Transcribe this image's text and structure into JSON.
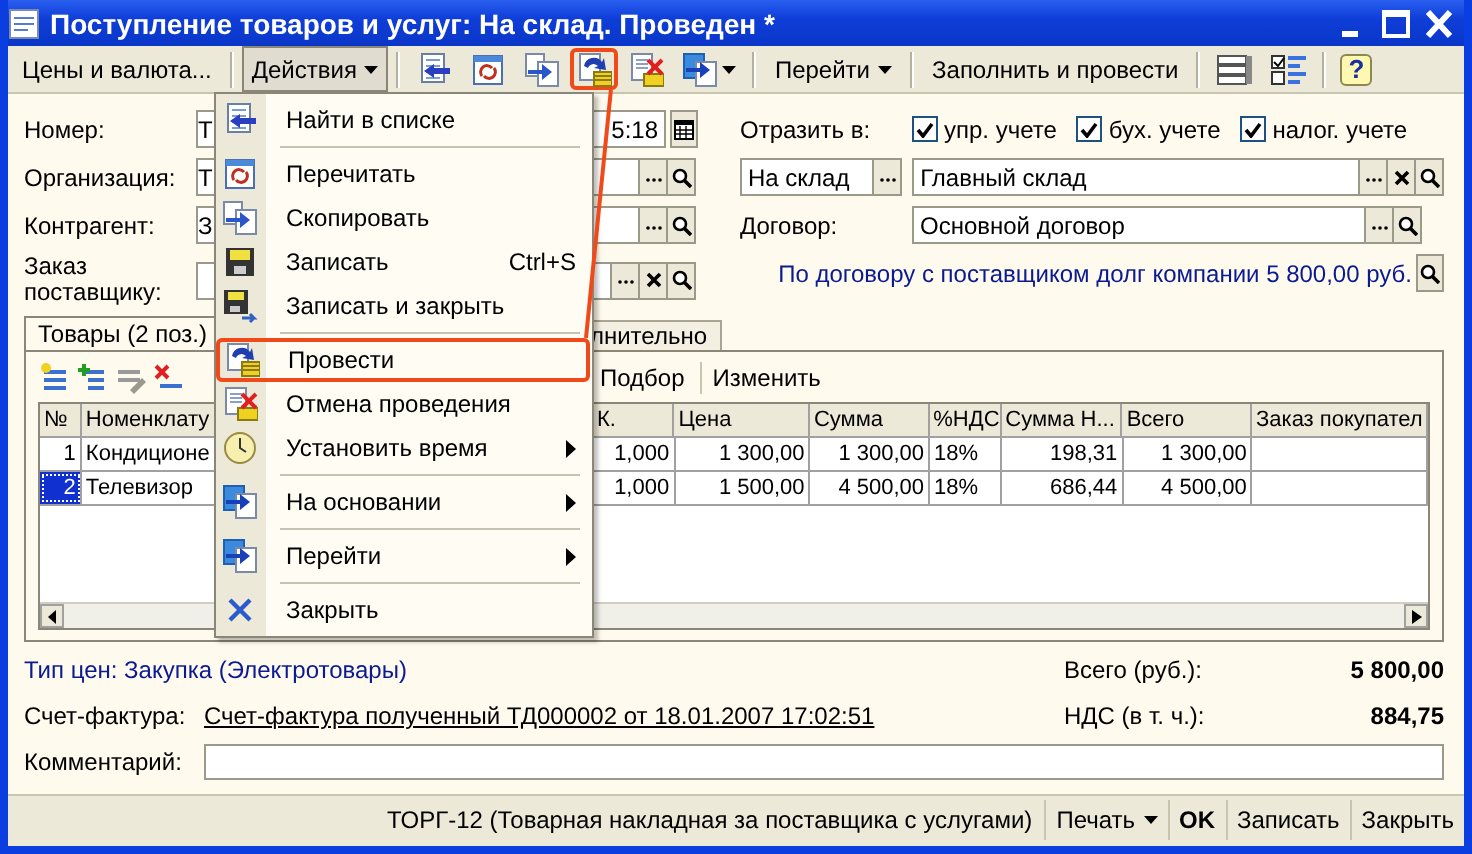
{
  "window": {
    "title": "Поступление товаров и услуг: На склад. Проведен *"
  },
  "toolbar": [
    {
      "kind": "button",
      "label": "Цены и валюта..."
    },
    {
      "kind": "separator"
    },
    {
      "kind": "menu",
      "label": "Действия",
      "open": true
    },
    {
      "kind": "separator"
    },
    {
      "kind": "icon",
      "highlighted": false,
      "dropdown": false
    },
    {
      "kind": "icon",
      "highlighted": false,
      "dropdown": false
    },
    {
      "kind": "icon",
      "highlighted": false,
      "dropdown": false
    },
    {
      "kind": "icon",
      "highlighted": true,
      "dropdown": false
    },
    {
      "kind": "icon",
      "highlighted": false,
      "dropdown": false
    },
    {
      "kind": "icon",
      "highlighted": false,
      "dropdown": true
    },
    {
      "kind": "separator"
    },
    {
      "kind": "menu",
      "label": "Перейти",
      "open": false
    },
    {
      "kind": "separator"
    },
    {
      "kind": "button",
      "label": "Заполнить и провести"
    },
    {
      "kind": "separator"
    },
    {
      "kind": "icon",
      "highlighted": false,
      "dropdown": false
    },
    {
      "kind": "icon",
      "highlighted": false,
      "dropdown": false
    },
    {
      "kind": "separator"
    },
    {
      "kind": "help",
      "label": "?"
    }
  ],
  "header": {
    "number": {
      "label": "Номер:",
      "value": "Т",
      "time": "5:18"
    },
    "organization": {
      "label": "Организация:",
      "value": "Т"
    },
    "counterparty": {
      "label": "Контрагент:",
      "value": "З"
    },
    "supplier_order": {
      "label": "Заказ поставщику:"
    },
    "reflect": {
      "label": "Отразить в:",
      "options": [
        {
          "label": "упр. учете",
          "checked": true
        },
        {
          "label": "бух. учете",
          "checked": true
        },
        {
          "label": "налог. учете",
          "checked": true
        }
      ]
    },
    "operation": {
      "value": "На склад"
    },
    "warehouse": {
      "value": "Главный склад"
    },
    "contract": {
      "label": "Договор:",
      "value": "Основной договор"
    },
    "debt_note": "По договору с поставщиком долг компании 5 800,00 руб."
  },
  "goods": {
    "tabs": [
      {
        "label": "Товары (2 поз.)",
        "selected": true
      },
      {
        "label": "лнительно",
        "selected": false
      }
    ],
    "toolbar_buttons": [
      "Подбор",
      "Изменить"
    ],
    "columns": [
      "№",
      "Номенклату",
      "К.",
      "Цена",
      "Сумма",
      "%НДС",
      "Сумма Н...",
      "Всего",
      "Заказ покупател"
    ],
    "rows": [
      {
        "selected": false,
        "cells": [
          "1",
          "Кондиционе",
          "1,000",
          "1 300,00",
          "1 300,00",
          "18%",
          "198,31",
          "1 300,00"
        ]
      },
      {
        "selected": true,
        "cells": [
          "2",
          "Телевизор",
          "1,000",
          "1 500,00",
          "4 500,00",
          "18%",
          "686,44",
          "4 500,00"
        ]
      }
    ]
  },
  "footer": {
    "price_type": "Тип цен: Закупка (Электротовары)",
    "invoice_label": "Счет-фактура:",
    "invoice_link": "Счет-фактура полученный ТД000002 от 18.01.2007 17:02:51",
    "total_label": "Всего (руб.):",
    "total": "5 800,00",
    "vat_label": "НДС (в т. ч.):",
    "vat": "884,75",
    "comment_label": "Комментарий:"
  },
  "bottom_bar": [
    {
      "kind": "text",
      "label": "ТОРГ-12 (Товарная накладная за поставщика с услугами)"
    },
    {
      "kind": "menu",
      "label": "Печать"
    },
    {
      "kind": "default",
      "label": "OK"
    },
    {
      "kind": "button",
      "label": "Записать"
    },
    {
      "kind": "button",
      "label": "Закрыть"
    }
  ],
  "actions_menu": [
    {
      "kind": "item",
      "label": "Найти в списке",
      "highlighted": false
    },
    {
      "kind": "separator"
    },
    {
      "kind": "item",
      "label": "Перечитать",
      "highlighted": false
    },
    {
      "kind": "item",
      "label": "Скопировать",
      "highlighted": false
    },
    {
      "kind": "item",
      "label": "Записать",
      "shortcut": "Ctrl+S",
      "highlighted": false
    },
    {
      "kind": "item",
      "label": "Записать и закрыть",
      "highlighted": false
    },
    {
      "kind": "separator"
    },
    {
      "kind": "item",
      "label": "Провести",
      "highlighted": true
    },
    {
      "kind": "item",
      "label": "Отмена проведения",
      "highlighted": false
    },
    {
      "kind": "item",
      "label": "Установить время",
      "submenu": true,
      "highlighted": false
    },
    {
      "kind": "separator"
    },
    {
      "kind": "item",
      "label": "На основании",
      "submenu": true,
      "highlighted": false
    },
    {
      "kind": "separator"
    },
    {
      "kind": "item",
      "label": "Перейти",
      "submenu": true,
      "highlighted": false
    },
    {
      "kind": "separator"
    },
    {
      "kind": "item",
      "label": "Закрыть",
      "highlighted": false
    }
  ]
}
